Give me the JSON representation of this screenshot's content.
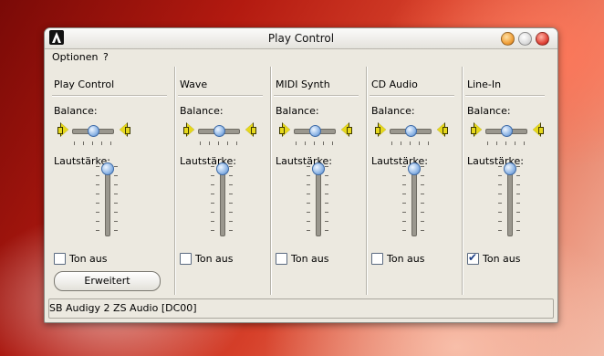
{
  "window": {
    "title": "Play Control"
  },
  "menu": {
    "items": [
      "Optionen",
      "?"
    ]
  },
  "labels": {
    "balance": "Balance:",
    "volume": "Lautstärke:",
    "mute": "Ton aus"
  },
  "channels": [
    {
      "name": "Play Control",
      "balance": 0.5,
      "volume": 1.0,
      "muted": false
    },
    {
      "name": "Wave",
      "balance": 0.5,
      "volume": 1.0,
      "muted": false
    },
    {
      "name": "MIDI Synth",
      "balance": 0.5,
      "volume": 1.0,
      "muted": false
    },
    {
      "name": "CD Audio",
      "balance": 0.5,
      "volume": 1.0,
      "muted": false
    },
    {
      "name": "Line-In",
      "balance": 0.5,
      "volume": 1.0,
      "muted": true
    }
  ],
  "advanced_button": {
    "label": "Erweitert"
  },
  "status": {
    "device": "SB Audigy 2 ZS Audio [DC00]"
  },
  "colors": {
    "slider_thumb": "#8fb6e6",
    "speaker": "#e6d81c",
    "window_bg": "#ece9e0"
  }
}
